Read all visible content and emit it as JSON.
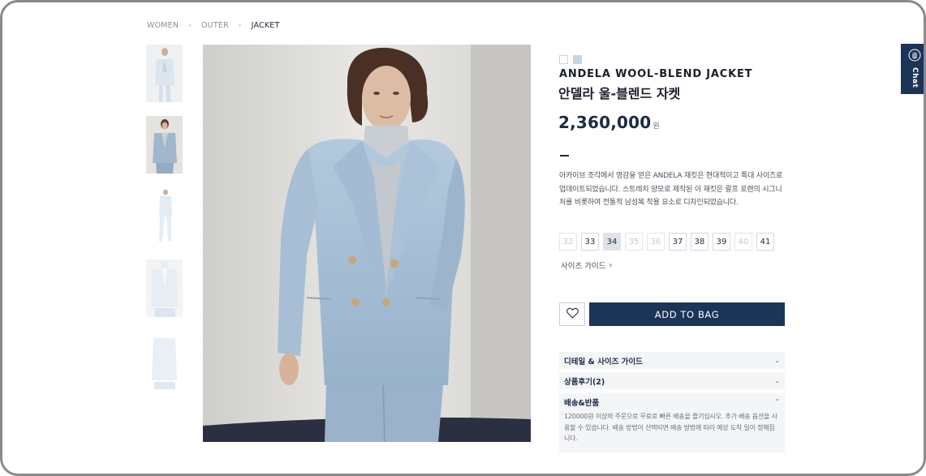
{
  "breadcrumb": [
    "WOMEN",
    "OUTER",
    "JACKET"
  ],
  "breadcrumb_separator": "›",
  "product": {
    "name_en": "ANDELA WOOL-BLEND JACKET",
    "name_ko": "안델라 울-블렌드 자켓",
    "price": "2,360,000",
    "currency": "원",
    "colors": [
      "#ffffff",
      "#c5d7e6"
    ],
    "description": "아카이브 조각에서 영감을 얻은 ANDELA 재킷은 현대적이고 특대 사이즈로 업데이트되었습니다. 스트레치 양모로 제작된 이 재킷은 랄프 로렌의 시그니처를 비롯하여 전통적 남성복 착용 요소로 디자인되었습니다."
  },
  "sizes": [
    {
      "label": "32",
      "state": "disabled"
    },
    {
      "label": "33",
      "state": "available"
    },
    {
      "label": "34",
      "state": "selected"
    },
    {
      "label": "35",
      "state": "disabled"
    },
    {
      "label": "36",
      "state": "disabled"
    },
    {
      "label": "37",
      "state": "available"
    },
    {
      "label": "38",
      "state": "available"
    },
    {
      "label": "39",
      "state": "available"
    },
    {
      "label": "40",
      "state": "disabled"
    },
    {
      "label": "41",
      "state": "available"
    }
  ],
  "size_guide_link": "사이즈 가이드",
  "actions": {
    "wishlist_icon": "heart-icon",
    "add_to_bag": "ADD TO BAG"
  },
  "accordion": [
    {
      "title": "디테일 & 사이즈 가이드",
      "expanded": false
    },
    {
      "title": "상품후기(2)",
      "expanded": false
    },
    {
      "title": "배송&반품",
      "expanded": true,
      "body": "120000원 이상의 주문으로 무료로 빠른 배송을 즐기십시오. 추가 배송 옵션을 사용할 수 있습니다. 배송 방법이 선택되면 배송 방법에 따라 예상 도착 일이 정해집니다."
    }
  ],
  "chat": {
    "label": "Chat",
    "icon": "chat-hand-icon"
  },
  "colors": {
    "brand_navy": "#1c3457",
    "selected_size_bg": "#dfe3e8",
    "accordion_bg": "#f4f5f7"
  }
}
